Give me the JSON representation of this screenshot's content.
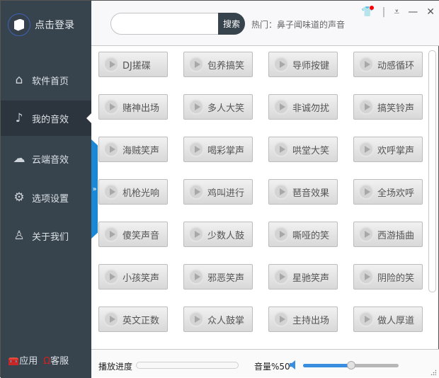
{
  "sidebar": {
    "login_label": "点击登录",
    "items": [
      {
        "label": "软件首页",
        "icon": "home-icon"
      },
      {
        "label": "我的音效",
        "icon": "music-monitor-icon",
        "selected": true
      },
      {
        "label": "云端音效",
        "icon": "cloud-download-icon"
      },
      {
        "label": "选项设置",
        "icon": "gear-icon"
      },
      {
        "label": "关于我们",
        "icon": "user-icon"
      }
    ],
    "apps_label": "应用",
    "service_label": "客服"
  },
  "header": {
    "search_placeholder": "",
    "search_button": "搜索",
    "hot_label": "热门：鼻子闻味道的声音"
  },
  "sounds": [
    "DJ搓碟",
    "包养搞笑",
    "导师按键",
    "动感循环",
    "赌神出场",
    "多人大笑",
    "非诚勿扰",
    "搞笑铃声",
    "海贼笑声",
    "喝彩掌声",
    "哄堂大笑",
    "欢呼掌声",
    "机枪光响",
    "鸡叫进行",
    "琶音效果",
    "全场欢呼",
    "傻笑声音",
    "少数人鼓",
    "嘶哑的笑",
    "西游插曲",
    "小孩笑声",
    "邪恶笑声",
    "星驰笑声",
    "阴险的笑",
    "英文正数",
    "众人鼓掌",
    "主持出场",
    "做人厚道"
  ],
  "player": {
    "progress_label": "播放进度",
    "progress": 0,
    "volume_label": "音量%50",
    "volume": 50
  },
  "colors": {
    "sidebar": "#37434d",
    "accent": "#1b88d6"
  }
}
